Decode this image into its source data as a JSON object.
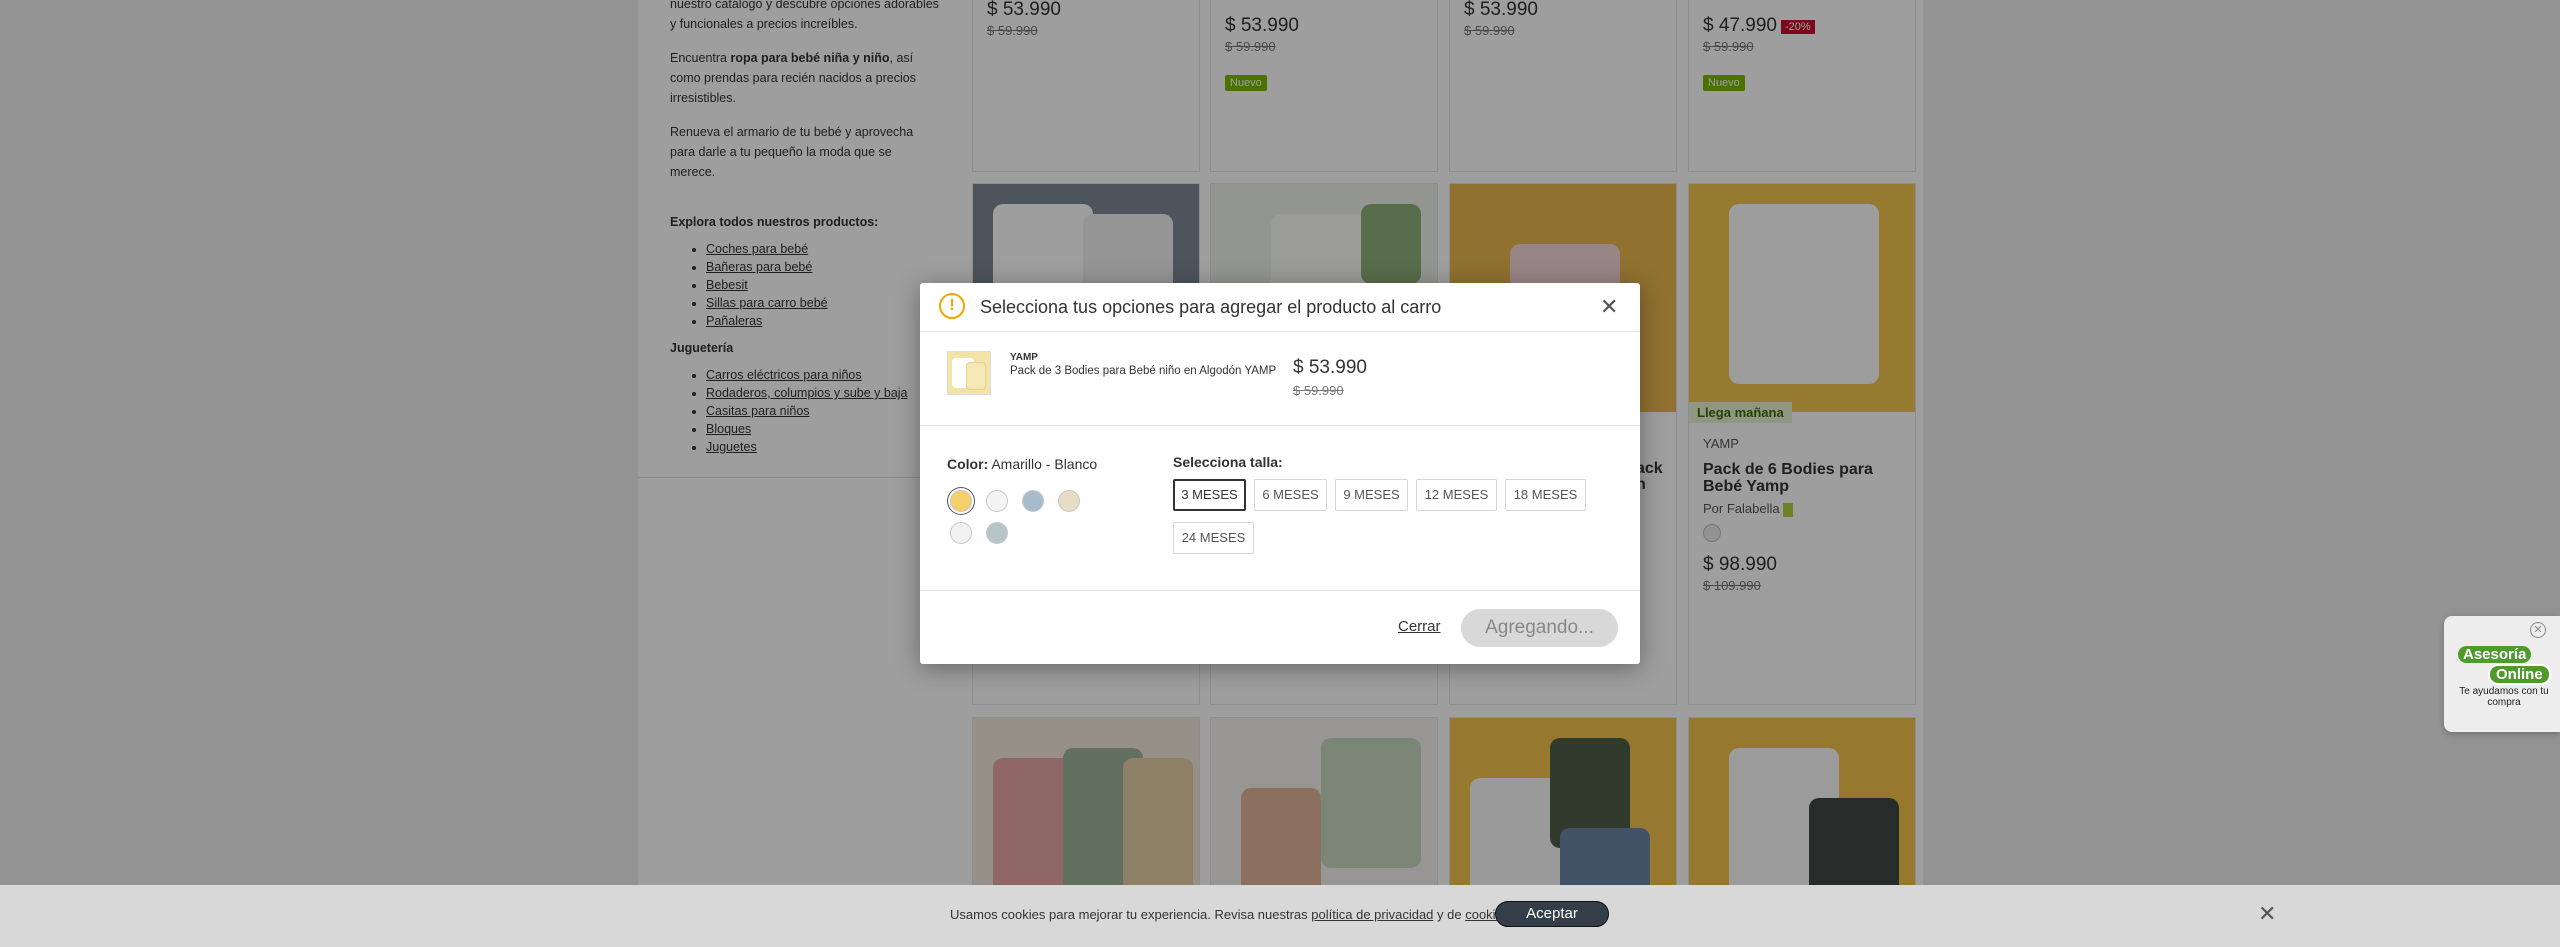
{
  "seo": {
    "p1": "nuestro catálogo y descubre opciones adorables y funcionales a precios increíbles.",
    "p2_pre": "Encuentra ",
    "p2_bold": "ropa para bebé niña y niño",
    "p2_post": ", así como prendas para recién nacidos a precios irresistibles.",
    "p3": "Renueva el armario de tu bebé y aprovecha para darle a tu pequeño la moda que se merece.",
    "explore_heading": "Explora todos nuestros productos:",
    "links1": [
      "Coches para bebé",
      "Bañeras para bebé",
      "Bebesit",
      "Sillas para carro bebé",
      "Pañaleras"
    ],
    "category2": "Juguetería",
    "links2": [
      "Carros eléctricos para niños",
      "Rodaderos, columpios y sube y baja",
      "Casitas para niños",
      "Bloques",
      "Juguetes"
    ]
  },
  "cards": {
    "c1": {
      "price": "$ 53.990",
      "old": "$ 59.990"
    },
    "c2": {
      "price": "$ 53.990",
      "old": "$ 59.990",
      "badge": "Nuevo"
    },
    "c3": {
      "price": "$ 53.990",
      "old": "$ 59.990"
    },
    "c4": {
      "price": "$ 47.990",
      "discount": "-20%",
      "old": "$ 59.990",
      "badge": "Nuevo"
    },
    "c8": {
      "shipping": "Llega mañana",
      "brand": "YAMP",
      "title": "Pack de 6 Bodies para Bebé Yamp",
      "seller": "Por Falabella",
      "price": "$ 98.990",
      "old": "$ 109.990"
    },
    "c7_partial": {
      "title_tail_1": "ack",
      "title_tail_2": "n"
    }
  },
  "modal": {
    "title": "Selecciona tus opciones para agregar el producto al carro",
    "brand": "YAMP",
    "product_name": "Pack de 3 Bodies para Bebé niño en Algodón YAMP",
    "price": "$ 53.990",
    "old_price": "$ 59.990",
    "color_label": "Color:",
    "color_value": "Amarillo - Blanco",
    "swatches": [
      "#f5cf6a",
      "#f4f4f4",
      "#a8bccb",
      "#e7dcc6",
      "#f1f1f1",
      "#b6c6c6"
    ],
    "size_label": "Selecciona talla:",
    "sizes": [
      "3 MESES",
      "6 MESES",
      "9 MESES",
      "12 MESES",
      "18 MESES",
      "24 MESES"
    ],
    "close_label": "Cerrar",
    "add_label": "Agregando..."
  },
  "cookie": {
    "text_pre": "Usamos cookies para mejorar tu experiencia. Revisa nuestras ",
    "privacy_link": "política de privacidad",
    "text_mid": " y de ",
    "cookies_link": "cookies",
    "text_post": ".",
    "accept": "Aceptar"
  },
  "chat": {
    "line1": "Asesoría",
    "line2": "Online",
    "sub": "Te ayudamos con tu compra"
  },
  "colors": {
    "new_badge": "#7ab800",
    "discount_badge": "#c8102e",
    "chat_green": "#4f9a2d",
    "warning": "#f0a500"
  }
}
